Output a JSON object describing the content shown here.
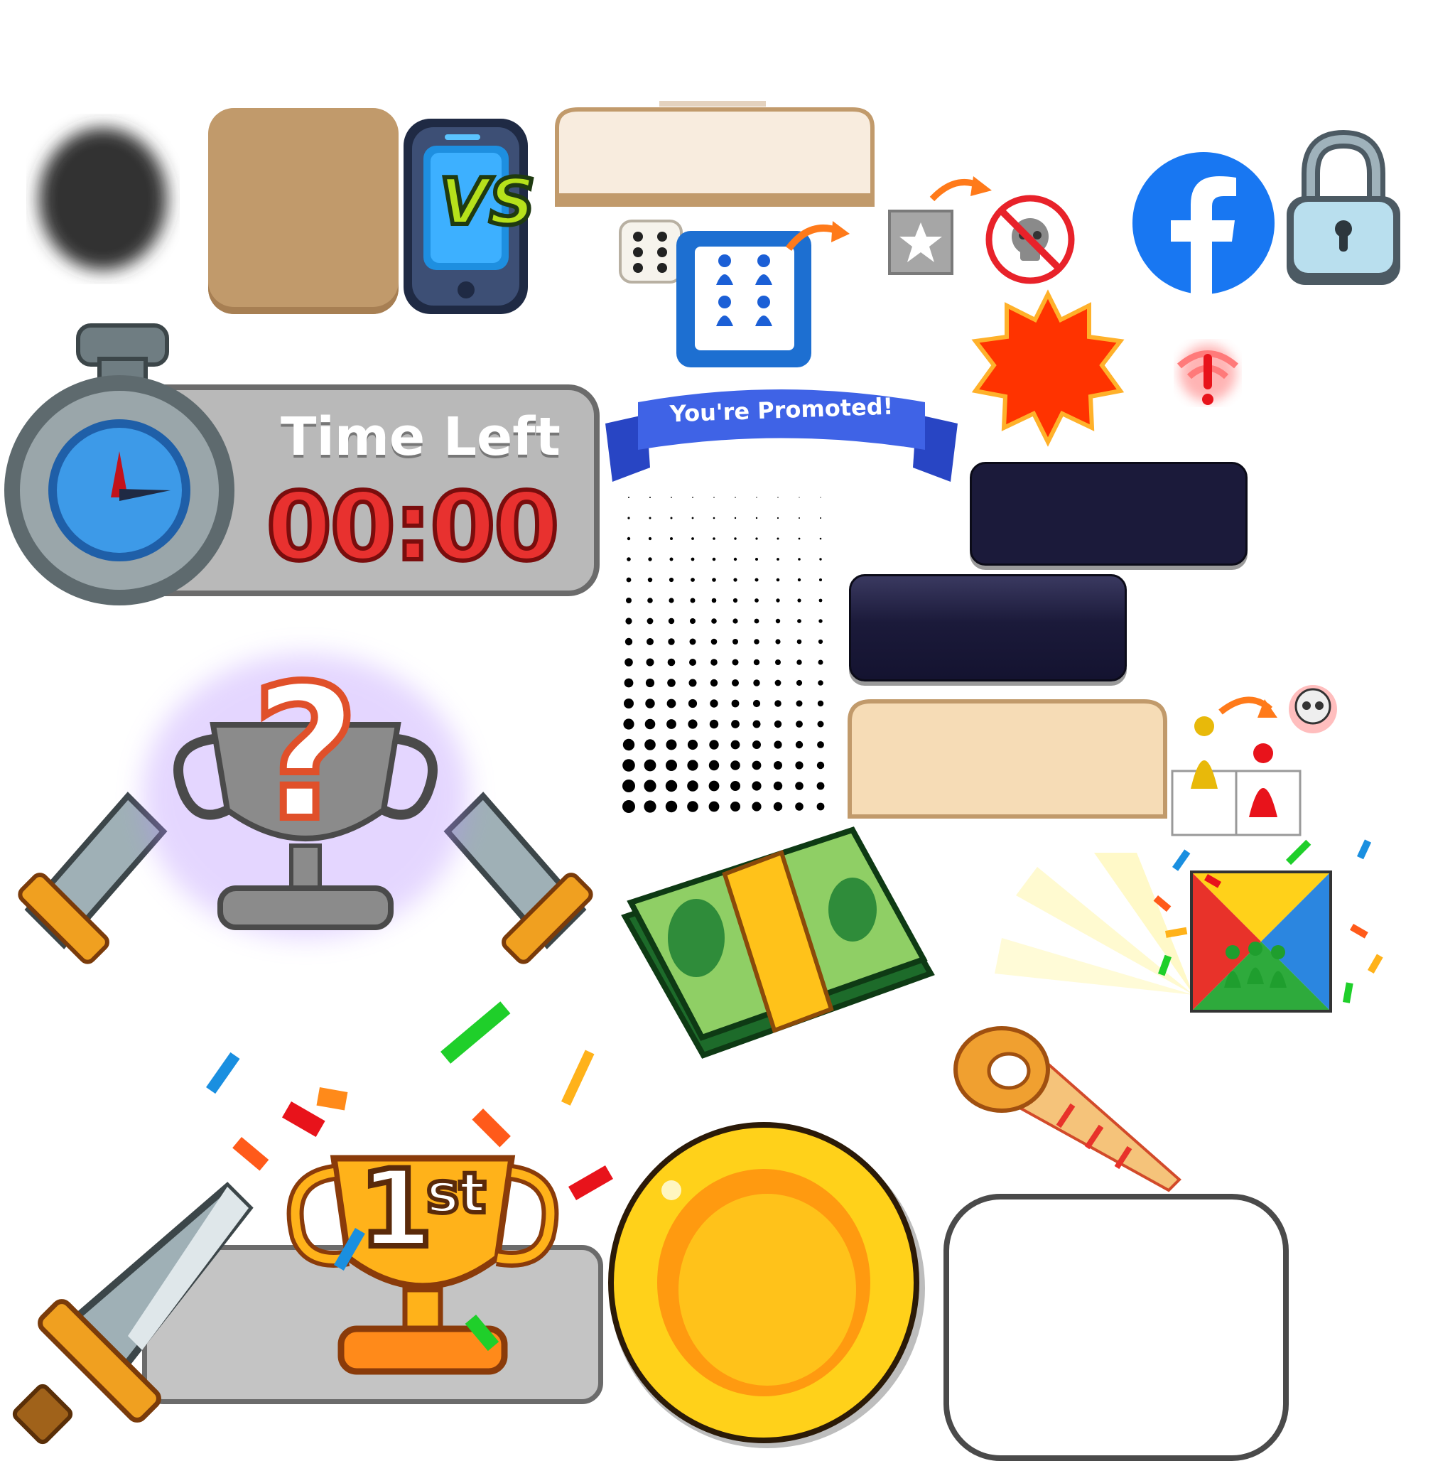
{
  "timer": {
    "title": "Time Left",
    "value": "00:00"
  },
  "ribbon": {
    "text": "You're Promoted!"
  },
  "vs_badge": {
    "text": "VS"
  },
  "first_place": {
    "number": "1",
    "suffix": "st"
  },
  "colors": {
    "timer_red": "#e8312f",
    "ribbon_blue": "#3f63e6",
    "facebook_blue": "#1877f2",
    "burst_red": "#ff3300",
    "coin_gold": "#ffc21a",
    "panel_grey": "#b9b9b9"
  },
  "icons": [
    "shadow-blob-icon",
    "tan-card-icon",
    "phone-vs-icon",
    "cream-header-panel-icon",
    "dice-icon",
    "pawn-board-icon",
    "star-badge-icon",
    "no-kill-icon",
    "facebook-icon",
    "lock-icon",
    "stopwatch-icon",
    "starburst-icon",
    "wifi-warning-icon",
    "dark-panel-icon",
    "halftone-icon",
    "mystery-trophy-icon",
    "pawn-kill-icon",
    "cash-stack-icon",
    "light-rays-icon",
    "ludo-board-icon",
    "party-horn-icon",
    "sword-icon",
    "gold-trophy-icon",
    "gold-coin-icon",
    "white-frame-icon",
    "confetti-icon"
  ]
}
